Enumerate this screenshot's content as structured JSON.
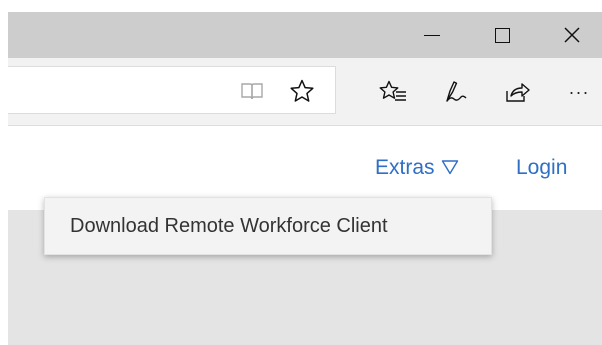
{
  "window": {
    "controls": {
      "minimize_icon": "minimize-icon",
      "maximize_icon": "maximize-icon",
      "close_icon": "close-icon"
    }
  },
  "toolbar": {
    "icons": [
      "reading-view-icon",
      "favorite-star-icon",
      "favorites-list-icon",
      "web-note-icon",
      "share-icon",
      "more-icon"
    ],
    "more_label": "···"
  },
  "site_header": {
    "extras_label": "Extras",
    "login_label": "Login",
    "link_color": "#2f6fc5"
  },
  "dropdown": {
    "items": [
      {
        "label": "Download Remote Workforce Client"
      }
    ]
  }
}
